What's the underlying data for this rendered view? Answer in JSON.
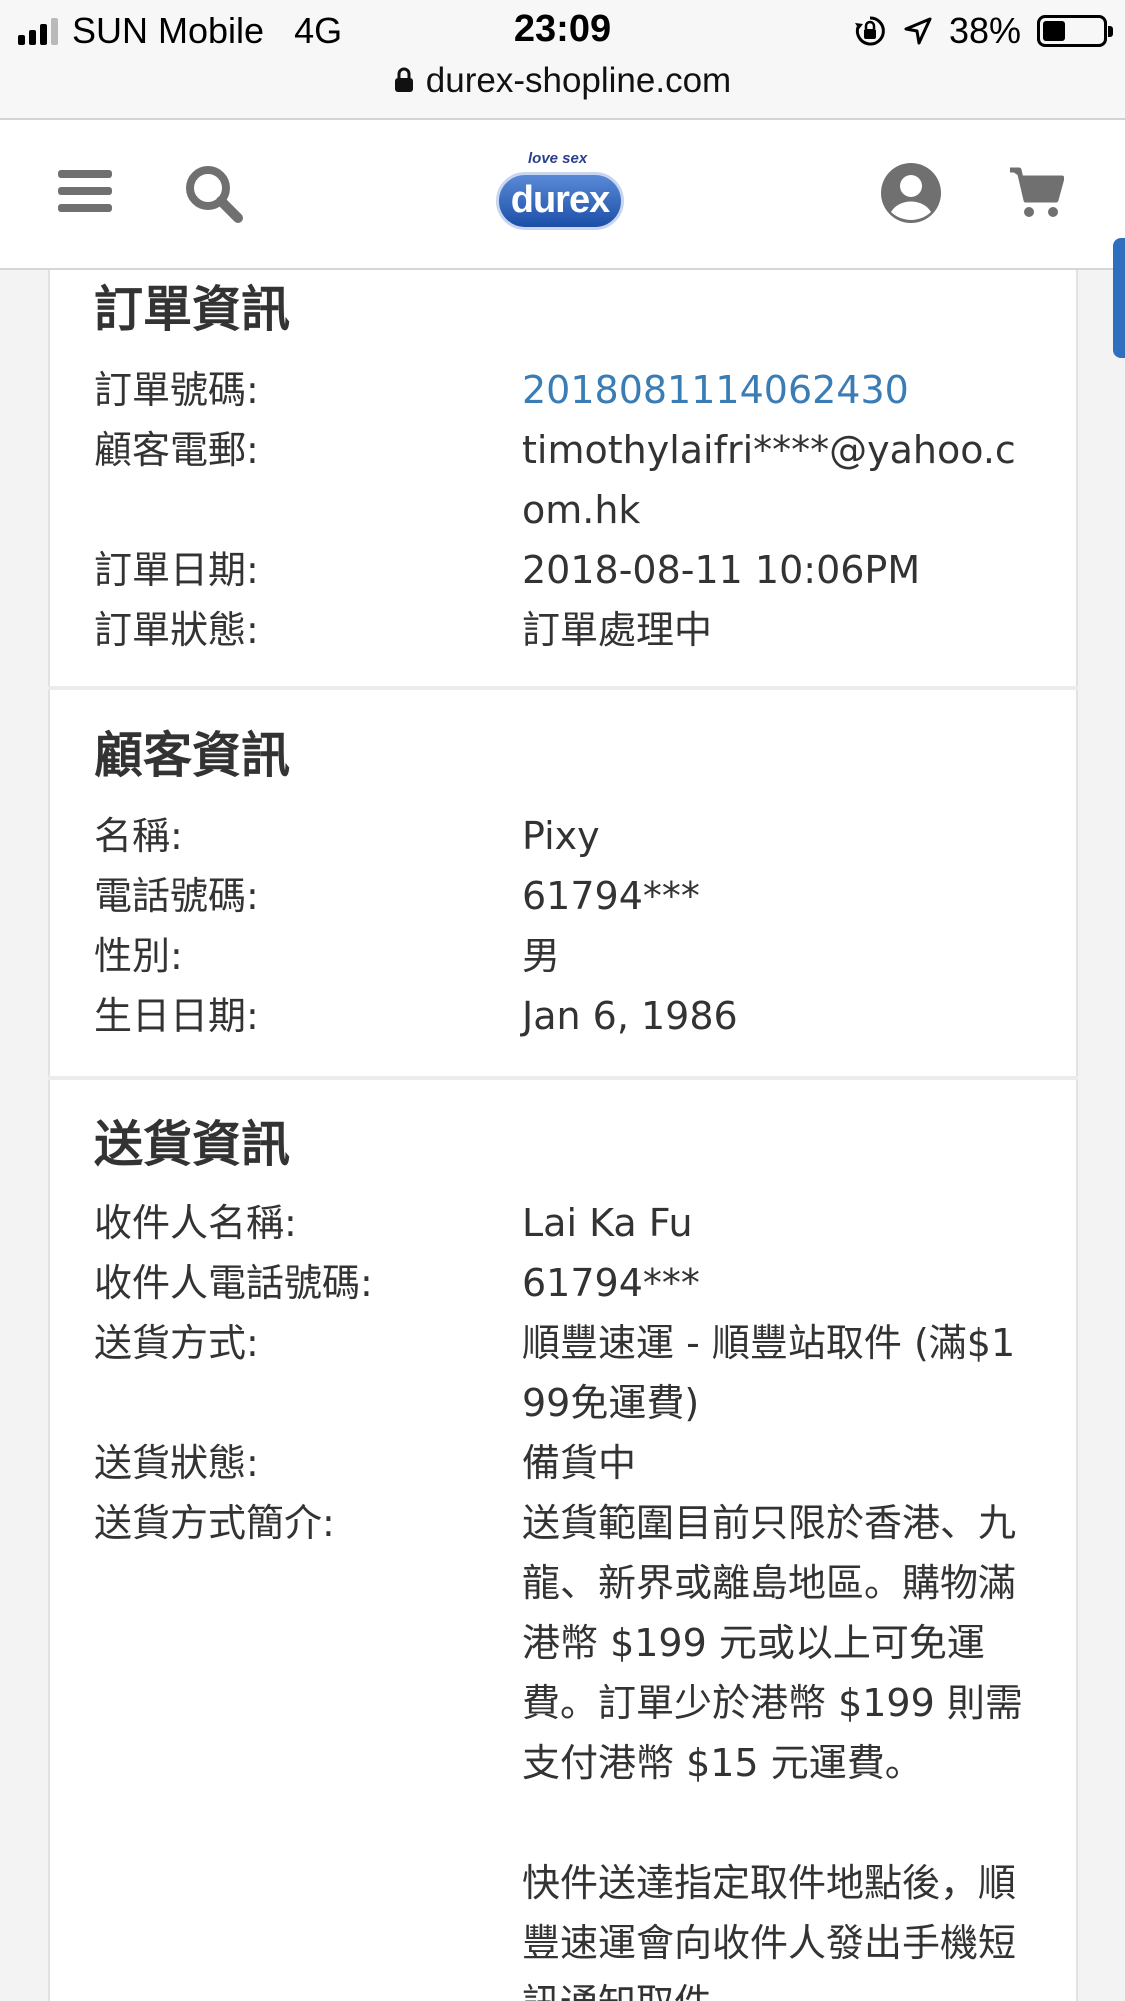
{
  "status_bar": {
    "carrier": "SUN Mobile",
    "network": "4G",
    "time": "23:09",
    "battery_text": "38%",
    "battery_level": 0.38
  },
  "browser": {
    "url": "durex-shopline.com"
  },
  "header": {
    "logo_tagline": "love sex",
    "logo_text": "durex"
  },
  "order_info": {
    "title": "訂單資訊",
    "rows": [
      {
        "label": "訂單號碼:",
        "value": "2018081114062430"
      },
      {
        "label": "顧客電郵:",
        "value": "timothylaifri****@yahoo.com.hk"
      },
      {
        "label": "訂單日期:",
        "value": "2018-08-11 10:06PM"
      },
      {
        "label": "訂單狀態:",
        "value": "訂單處理中"
      }
    ]
  },
  "customer_info": {
    "title": "顧客資訊",
    "rows": [
      {
        "label": "名稱:",
        "value": "Pixy"
      },
      {
        "label": "電話號碼:",
        "value": "61794***"
      },
      {
        "label": "性別:",
        "value": "男"
      },
      {
        "label": "生日日期:",
        "value": "Jan 6, 1986"
      }
    ]
  },
  "delivery_info": {
    "title": "送貨資訊",
    "rows": [
      {
        "label": "收件人名稱:",
        "value": "Lai Ka Fu"
      },
      {
        "label": "收件人電話號碼:",
        "value": "61794***"
      },
      {
        "label": "送貨方式:",
        "value": "順豐速運 - 順豐站取件 (滿$199免運費)"
      },
      {
        "label": "送貨狀態:",
        "value": "備貨中"
      },
      {
        "label": "送貨方式簡介:",
        "value": "送貨範圍目前只限於香港、九龍、新界或離島地區。購物滿港幣 $199 元或以上可免運費。訂單少於港幣 $199 則需支付港幣 $15 元運費。"
      }
    ],
    "description_continued": "快件送達指定取件地點後，順豐速運會向收件人發出手機短訊通知取件"
  }
}
